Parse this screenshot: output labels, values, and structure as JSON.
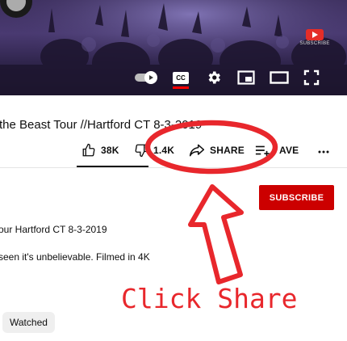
{
  "video": {
    "watermark_text": "SUBSCRIBE",
    "controls": {
      "autoplay_icon": "autoplay-toggle-icon",
      "cc_label": "CC",
      "settings_icon": "gear-icon",
      "miniplayer_icon": "miniplayer-icon",
      "theater_icon": "theater-mode-icon",
      "fullscreen_icon": "fullscreen-icon"
    }
  },
  "title": "the Beast Tour //Hartford CT 8-3-2019",
  "actions": {
    "like_count": "38K",
    "dislike_count": "1.4K",
    "share_label": "SHARE",
    "save_label": "AVE",
    "more_icon": "more-vertical-icon"
  },
  "channel": {
    "subscribe_label": "SUBSCRIBE"
  },
  "description": {
    "line1": "our Hartford CT  8-3-2019",
    "line2": " seen it's unbelievable. Filmed in 4K"
  },
  "chips": {
    "watched": "Watched"
  },
  "annotation": {
    "text": "Click Share",
    "color": "#e8272c"
  },
  "colors": {
    "subscribe": "#cc0000",
    "cc_underline": "#ff0000",
    "annotation": "#e8272c"
  }
}
